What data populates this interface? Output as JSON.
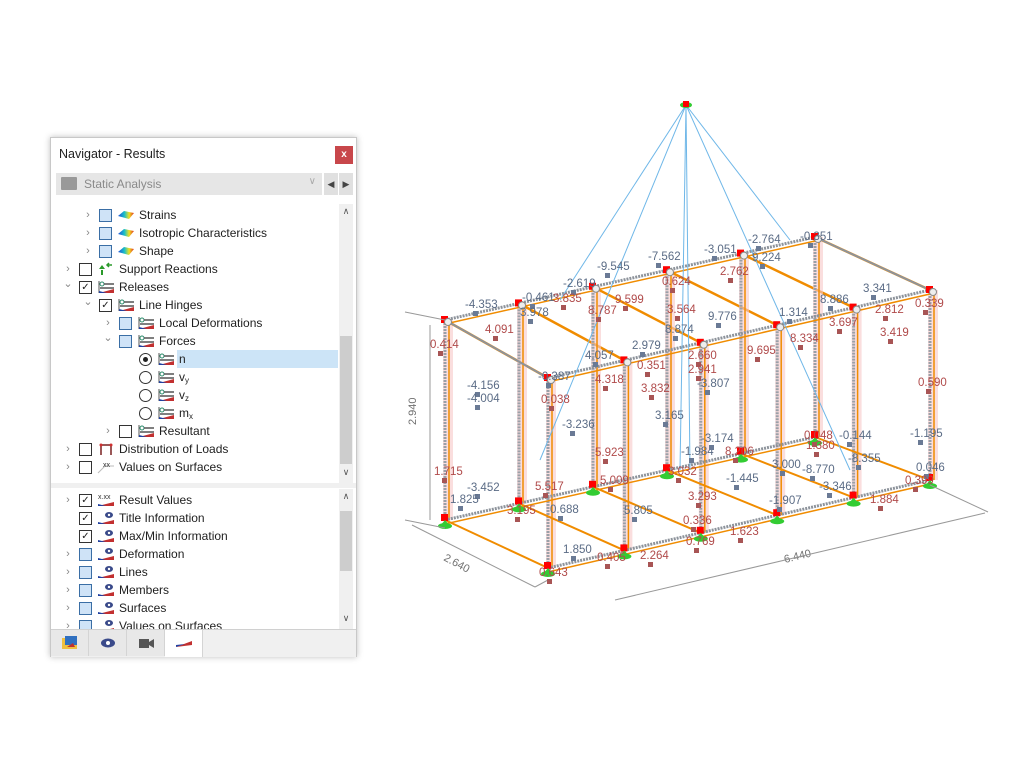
{
  "navigator": {
    "title": "Navigator - Results",
    "close_label": "x",
    "combo": {
      "selected": "Static Analysis"
    },
    "tree_top": [
      {
        "label": "Strains",
        "level": 2,
        "check": "blue",
        "icon": "surface-gradient-icon",
        "expander": "collapsed"
      },
      {
        "label": "Isotropic Characteristics",
        "level": 2,
        "check": "blue",
        "icon": "surface-gradient-icon",
        "expander": "collapsed"
      },
      {
        "label": "Shape",
        "level": 2,
        "check": "blue",
        "icon": "surface-gradient-icon",
        "expander": "collapsed"
      },
      {
        "label": "Support Reactions",
        "level": 1,
        "check": "empty",
        "icon": "support-reactions-icon",
        "expander": "collapsed"
      },
      {
        "label": "Releases",
        "level": 1,
        "check": "checked",
        "icon": "release-icon",
        "expander": "expanded"
      },
      {
        "label": "Line Hinges",
        "level": 2,
        "check": "checked",
        "icon": "release-icon",
        "expander": "expanded"
      },
      {
        "label": "Local Deformations",
        "level": 3,
        "check": "blue",
        "icon": "release-icon",
        "expander": "collapsed"
      },
      {
        "label": "Forces",
        "level": 3,
        "check": "blue",
        "icon": "release-icon",
        "expander": "expanded"
      },
      {
        "label": "n",
        "sub": "",
        "level": 4,
        "radio": "on",
        "icon": "release-icon",
        "selected": true
      },
      {
        "label": "v",
        "sub": "y",
        "level": 4,
        "radio": "off",
        "icon": "release-icon"
      },
      {
        "label": "v",
        "sub": "z",
        "level": 4,
        "radio": "off",
        "icon": "release-icon"
      },
      {
        "label": "m",
        "sub": "x",
        "level": 4,
        "radio": "off",
        "icon": "release-icon"
      },
      {
        "label": "Resultant",
        "level": 3,
        "check": "empty",
        "icon": "release-icon",
        "expander": "collapsed"
      },
      {
        "label": "Distribution of Loads",
        "level": 1,
        "check": "empty",
        "icon": "load-distribution-icon",
        "expander": "collapsed"
      },
      {
        "label": "Values on Surfaces",
        "level": 1,
        "check": "empty",
        "icon": "values-on-surfaces-icon",
        "expander": "collapsed"
      }
    ],
    "tree_bottom": [
      {
        "label": "Result Values",
        "check": "checked",
        "icon": "result-values-icon",
        "expander": "collapsed",
        "icon_text": "x.xx"
      },
      {
        "label": "Title Information",
        "check": "checked",
        "icon": "display-eye-icon"
      },
      {
        "label": "Max/Min Information",
        "check": "checked",
        "icon": "display-eye-icon"
      },
      {
        "label": "Deformation",
        "check": "blue",
        "icon": "display-eye-icon",
        "expander": "collapsed"
      },
      {
        "label": "Lines",
        "check": "blue",
        "icon": "display-eye-icon",
        "expander": "collapsed"
      },
      {
        "label": "Members",
        "check": "blue",
        "icon": "display-eye-icon",
        "expander": "collapsed"
      },
      {
        "label": "Surfaces",
        "check": "blue",
        "icon": "display-eye-icon",
        "expander": "collapsed"
      },
      {
        "label": "Values on Surfaces",
        "check": "blue",
        "icon": "display-eye-icon",
        "expander": "collapsed"
      }
    ],
    "tabs": [
      {
        "name": "data-tab",
        "icon": "folder-data-icon"
      },
      {
        "name": "display-tab",
        "icon": "eye-icon"
      },
      {
        "name": "views-tab",
        "icon": "camera-icon"
      },
      {
        "name": "results-tab",
        "icon": "results-icon",
        "active": true
      }
    ]
  },
  "model": {
    "colors": {
      "negative": "#5a6b85",
      "positive": "#b04a4a",
      "beam": "#f08c00",
      "cable": "#6fb7e8",
      "support": "#33cc33",
      "hinge": "#ff0000"
    },
    "dimensions": {
      "height": "2.940",
      "width": "2.640",
      "length": "6.440"
    },
    "result_values": [
      {
        "v": "-4.353",
        "s": "neg"
      },
      {
        "v": "-0.461",
        "s": "neg"
      },
      {
        "v": "-2.619",
        "s": "neg"
      },
      {
        "v": "-9.545",
        "s": "neg"
      },
      {
        "v": "-7.562",
        "s": "neg"
      },
      {
        "v": "-3.051",
        "s": "neg"
      },
      {
        "v": "-2.764",
        "s": "neg"
      },
      {
        "v": "-0.351",
        "s": "neg"
      },
      {
        "v": "0.414",
        "s": "pos"
      },
      {
        "v": "4.091",
        "s": "pos"
      },
      {
        "v": "3.978",
        "s": "neg"
      },
      {
        "v": "3.835",
        "s": "pos"
      },
      {
        "v": "8.787",
        "s": "pos"
      },
      {
        "v": "9.599",
        "s": "pos"
      },
      {
        "v": "0.624",
        "s": "pos"
      },
      {
        "v": "3.564",
        "s": "pos"
      },
      {
        "v": "2.762",
        "s": "pos"
      },
      {
        "v": "9.224",
        "s": "neg"
      },
      {
        "v": "8.874",
        "s": "neg"
      },
      {
        "v": "9.776",
        "s": "neg"
      },
      {
        "v": "8.886",
        "s": "neg"
      },
      {
        "v": "3.341",
        "s": "neg"
      },
      {
        "v": "0.339",
        "s": "pos"
      },
      {
        "v": "1.314",
        "s": "neg"
      },
      {
        "v": "3.697",
        "s": "pos"
      },
      {
        "v": "2.812",
        "s": "pos"
      },
      {
        "v": "3.419",
        "s": "pos"
      },
      {
        "v": "8.334",
        "s": "pos"
      },
      {
        "v": "9.695",
        "s": "pos"
      },
      {
        "v": "2.660",
        "s": "pos"
      },
      {
        "v": "2.941",
        "s": "pos"
      },
      {
        "v": "-3.807",
        "s": "neg"
      },
      {
        "v": "0.590",
        "s": "pos"
      },
      {
        "v": "2.979",
        "s": "neg"
      },
      {
        "v": "4.057",
        "s": "neg"
      },
      {
        "v": "0.351",
        "s": "pos"
      },
      {
        "v": "4.318",
        "s": "pos"
      },
      {
        "v": "3.832",
        "s": "pos"
      },
      {
        "v": "-0.387",
        "s": "neg"
      },
      {
        "v": "0.038",
        "s": "pos"
      },
      {
        "v": "-4.156",
        "s": "neg"
      },
      {
        "v": "-4.004",
        "s": "neg"
      },
      {
        "v": "-3.236",
        "s": "neg"
      },
      {
        "v": "3.165",
        "s": "neg"
      },
      {
        "v": "1.380",
        "s": "pos"
      },
      {
        "v": "-1.195",
        "s": "neg"
      },
      {
        "v": "5.923",
        "s": "pos"
      },
      {
        "v": "-1.984",
        "s": "neg"
      },
      {
        "v": "-3.174",
        "s": "neg"
      },
      {
        "v": "0.048",
        "s": "pos"
      },
      {
        "v": "-0.144",
        "s": "neg"
      },
      {
        "v": "1.715",
        "s": "pos"
      },
      {
        "v": "-3.452",
        "s": "neg"
      },
      {
        "v": "5.517",
        "s": "pos"
      },
      {
        "v": "5.009",
        "s": "pos"
      },
      {
        "v": "3.032",
        "s": "pos"
      },
      {
        "v": "8.206",
        "s": "pos"
      },
      {
        "v": "-8.355",
        "s": "neg"
      },
      {
        "v": "3.000",
        "s": "neg"
      },
      {
        "v": "-8.770",
        "s": "neg"
      },
      {
        "v": "0.046",
        "s": "neg"
      },
      {
        "v": "1.825",
        "s": "neg"
      },
      {
        "v": "3.195",
        "s": "pos"
      },
      {
        "v": "0.688",
        "s": "neg"
      },
      {
        "v": "5.805",
        "s": "neg"
      },
      {
        "v": "-1.445",
        "s": "neg"
      },
      {
        "v": "-3.346",
        "s": "neg"
      },
      {
        "v": "0.399",
        "s": "pos"
      },
      {
        "v": "3.293",
        "s": "pos"
      },
      {
        "v": "-1.907",
        "s": "neg"
      },
      {
        "v": "1.884",
        "s": "pos"
      },
      {
        "v": "0.336",
        "s": "pos"
      },
      {
        "v": "1.850",
        "s": "neg"
      },
      {
        "v": "0.405",
        "s": "pos"
      },
      {
        "v": "2.264",
        "s": "pos"
      },
      {
        "v": "1.623",
        "s": "pos"
      },
      {
        "v": "0.769",
        "s": "pos"
      },
      {
        "v": "0.643",
        "s": "pos"
      }
    ]
  }
}
